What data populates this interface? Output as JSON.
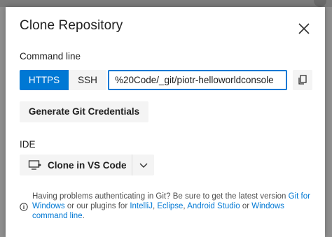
{
  "dialog": {
    "title": "Clone Repository",
    "close_icon": "close-icon"
  },
  "command_line": {
    "label": "Command line",
    "protocols": [
      {
        "label": "HTTPS",
        "selected": true
      },
      {
        "label": "SSH",
        "selected": false
      }
    ],
    "clone_url_value": "%20Code/_git/piotr-helloworldconsole",
    "copy_icon": "copy-icon",
    "generate_credentials_label": "Generate Git Credentials"
  },
  "ide": {
    "label": "IDE",
    "clone_button_label": "Clone in VS Code",
    "clone_icon": "monitor-icon",
    "dropdown_icon": "chevron-down-icon"
  },
  "help": {
    "info_icon": "info-icon",
    "text_before": "Having problems authenticating in Git? Be sure to get the latest version ",
    "link_git_for_windows": "Git for Windows",
    "text_mid1": " or our plugins for ",
    "link_intellij": "IntelliJ",
    "sep1": ", ",
    "link_eclipse": "Eclipse",
    "sep2": ", ",
    "link_android_studio": "Android Studio",
    "text_mid2": " or ",
    "link_windows_command_line": "Windows command line",
    "text_end": "."
  },
  "colors": {
    "accent": "#0078d4",
    "button_bg": "#f4f4f4",
    "text": "#202020",
    "muted_text": "#505050"
  }
}
